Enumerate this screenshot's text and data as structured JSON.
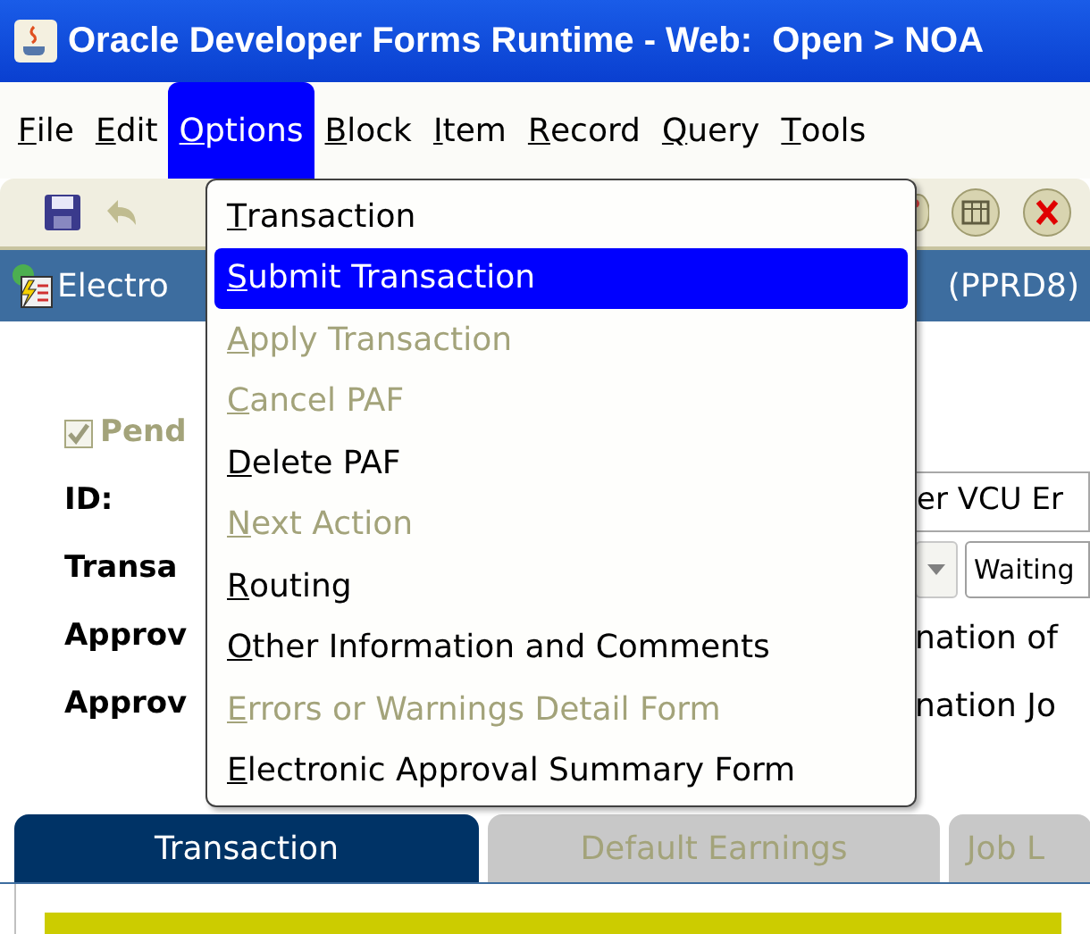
{
  "window": {
    "title": "Oracle Developer Forms Runtime - Web:  Open > NOA"
  },
  "menu_bar": [
    {
      "label": "File",
      "selected": false
    },
    {
      "label": "Edit",
      "selected": false
    },
    {
      "label": "Options",
      "selected": true
    },
    {
      "label": "Block",
      "selected": false
    },
    {
      "label": "Item",
      "selected": false
    },
    {
      "label": "Record",
      "selected": false
    },
    {
      "label": "Query",
      "selected": false
    },
    {
      "label": "Tools",
      "selected": false
    }
  ],
  "form_header": {
    "title_left": "Electro",
    "title_right": "(PPRD8)"
  },
  "fields": [
    {
      "kind": "checkbox",
      "label": "Pend",
      "checked": true,
      "disabled": true
    },
    {
      "kind": "field",
      "label": "ID:",
      "value": "er VCU Er"
    },
    {
      "kind": "select",
      "label": "Transa",
      "value": "Waiting"
    },
    {
      "kind": "text",
      "label": "Approv",
      "value": "nation of"
    },
    {
      "kind": "text",
      "label": "Approv",
      "value": "nation Jo"
    }
  ],
  "options_menu": {
    "items": [
      {
        "label": "Transaction",
        "selected": false,
        "disabled": false
      },
      {
        "label": "Submit Transaction",
        "selected": true,
        "disabled": false
      },
      {
        "label": "Apply Transaction",
        "selected": false,
        "disabled": true
      },
      {
        "label": "Cancel PAF",
        "selected": false,
        "disabled": true
      },
      {
        "label": "Delete PAF",
        "selected": false,
        "disabled": false
      },
      {
        "label": "Next Action",
        "selected": false,
        "disabled": true
      },
      {
        "label": "Routing",
        "selected": false,
        "disabled": false
      },
      {
        "label": "Other Information and Comments",
        "selected": false,
        "disabled": false
      },
      {
        "label": "Errors or Warnings Detail Form",
        "selected": false,
        "disabled": true
      },
      {
        "label": "Electronic Approval Summary Form",
        "selected": false,
        "disabled": false
      }
    ]
  },
  "tabs": [
    {
      "label": "Transaction",
      "selected": true
    },
    {
      "label": "Default Earnings",
      "selected": false
    },
    {
      "label": "Job L",
      "selected": false
    }
  ]
}
